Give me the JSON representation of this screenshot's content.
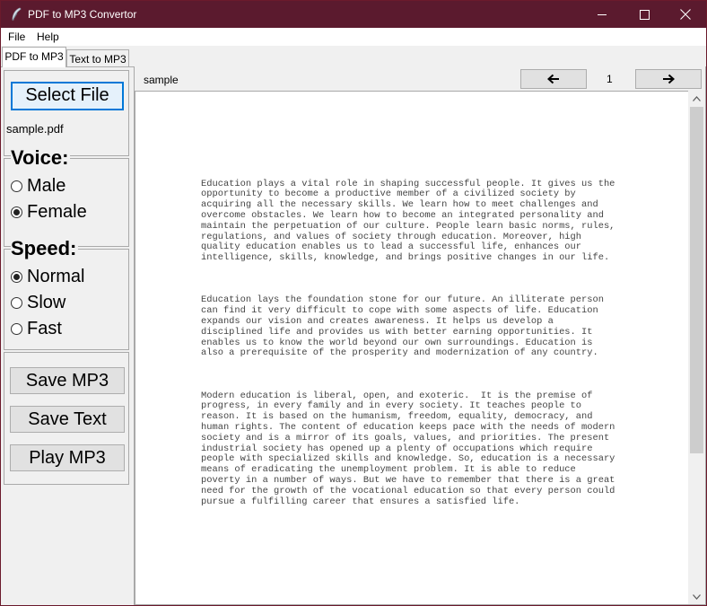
{
  "window": {
    "title": "PDF to MP3 Convertor"
  },
  "menu": {
    "file": "File",
    "help": "Help"
  },
  "tabs": {
    "pdf_to_mp3": "PDF to MP3",
    "text_to_mp3": "Text to MP3"
  },
  "left": {
    "select_file": "Select File",
    "file_name": "sample.pdf",
    "voice_label": "Voice:",
    "voice_options": [
      "Male",
      "Female"
    ],
    "voice_selected": "Female",
    "speed_label": "Speed:",
    "speed_options": [
      "Normal",
      "Slow",
      "Fast"
    ],
    "speed_selected": "Normal",
    "save_mp3": "Save MP3",
    "save_text": "Save Text",
    "play_mp3": "Play MP3"
  },
  "viewer": {
    "doc_title": "sample",
    "page": "1",
    "paragraphs": [
      "Education plays a vital role in shaping successful people. It gives us the\nopportunity to become a productive member of a civilized society by\nacquiring all the necessary skills. We learn how to meet challenges and\novercome obstacles. We learn how to become an integrated personality and\nmaintain the perpetuation of our culture. People learn basic norms, rules,\nregulations, and values of society through education. Moreover, high\nquality education enables us to lead a successful life, enhances our\nintelligence, skills, knowledge, and brings positive changes in our life.",
      "Education lays the foundation stone for our future. An illiterate person\ncan find it very difficult to cope with some aspects of life. Education\nexpands our vision and creates awareness. It helps us develop a\ndisciplined life and provides us with better earning opportunities. It\nenables us to know the world beyond our own surroundings. Education is\nalso a prerequisite of the prosperity and modernization of any country.",
      "Modern education is liberal, open, and exoteric.  It is the premise of\nprogress, in every family and in every society. It teaches people to\nreason. It is based on the humanism, freedom, equality, democracy, and\nhuman rights. The content of education keeps pace with the needs of modern\nsociety and is a mirror of its goals, values, and priorities. The present\nindustrial society has opened up a plenty of occupations which require\npeople with specialized skills and knowledge. So, education is a necessary\nmeans of eradicating the unemployment problem. It is able to reduce\npoverty in a number of ways. But we have to remember that there is a great\nneed for the growth of the vocational education so that every person could\npursue a fulfilling career that ensures a satisfied life."
    ]
  },
  "icons": {
    "app": "feather-icon",
    "minimize": "minimize-icon",
    "maximize": "maximize-icon",
    "close": "close-icon",
    "prev": "arrow-left-icon",
    "next": "arrow-right-icon"
  },
  "colors": {
    "titlebar": "#5b1a2e",
    "focus": "#0078d7"
  }
}
